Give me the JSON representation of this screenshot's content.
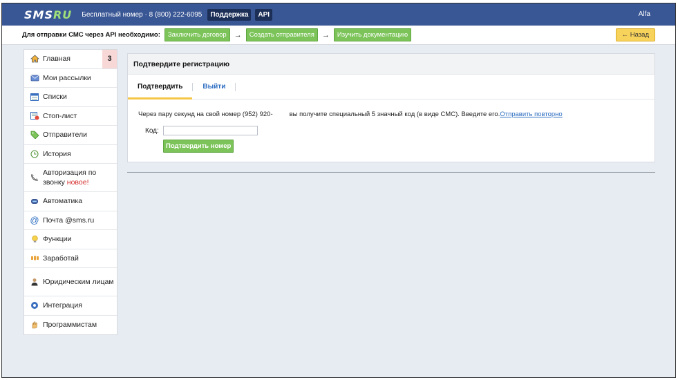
{
  "topbar": {
    "logo_main": "SMS",
    "logo_suffix": "RU",
    "free_number": "Бесплатный номер · 8 (800) 222-6095",
    "support_label": "Поддержка",
    "api_label": "API",
    "user_name": "Alfa"
  },
  "apibar": {
    "lead": "Для отправки СМС через API необходимо:",
    "steps": [
      "Заключить договор",
      "Создать отправителя",
      "Изучить документацию"
    ],
    "arrow": "→",
    "back_label": "← Назад"
  },
  "sidebar": {
    "items": [
      {
        "label": "Главная",
        "icon": "home-icon",
        "badge": "3"
      },
      {
        "label": "Мои рассылки",
        "icon": "mail-icon"
      },
      {
        "label": "Списки",
        "icon": "list-icon"
      },
      {
        "label": "Стоп-лист",
        "icon": "stop-list-icon"
      },
      {
        "label": "Отправители",
        "icon": "tag-icon"
      },
      {
        "label": "История",
        "icon": "history-icon"
      },
      {
        "label": "Авторизация по звонку",
        "icon": "phone-icon",
        "suffix": "новое!"
      },
      {
        "label": "Автоматика",
        "icon": "robot-icon"
      },
      {
        "label": "Почта @sms.ru",
        "icon": "at-icon"
      },
      {
        "label": "Функции",
        "icon": "bulb-icon"
      },
      {
        "label": "Заработай",
        "icon": "money-icon"
      },
      {
        "label": "Юридическим лицам",
        "icon": "person-icon"
      },
      {
        "label": "Интеграция",
        "icon": "integration-icon"
      },
      {
        "label": "Программистам",
        "icon": "hand-icon"
      }
    ]
  },
  "panel": {
    "title": "Подтвердите регистрацию",
    "tabs": [
      {
        "label": "Подтвердить"
      },
      {
        "label": "Выйти"
      }
    ],
    "message_part1": "Через пару секунд на свой номер (952) 920-",
    "message_part2": "вы получите специальный 5 значный код (в виде СМС). Введите его.",
    "resend_link": "Отправить повторно",
    "code_label": "Код:",
    "code_value": "",
    "confirm_button": "Подтвердить номер"
  },
  "colors": {
    "topbar": "#3a5795",
    "green": "#7cc45a",
    "yellow": "#f8d35c",
    "link": "#2b6cc0",
    "new": "#d42a2a"
  }
}
